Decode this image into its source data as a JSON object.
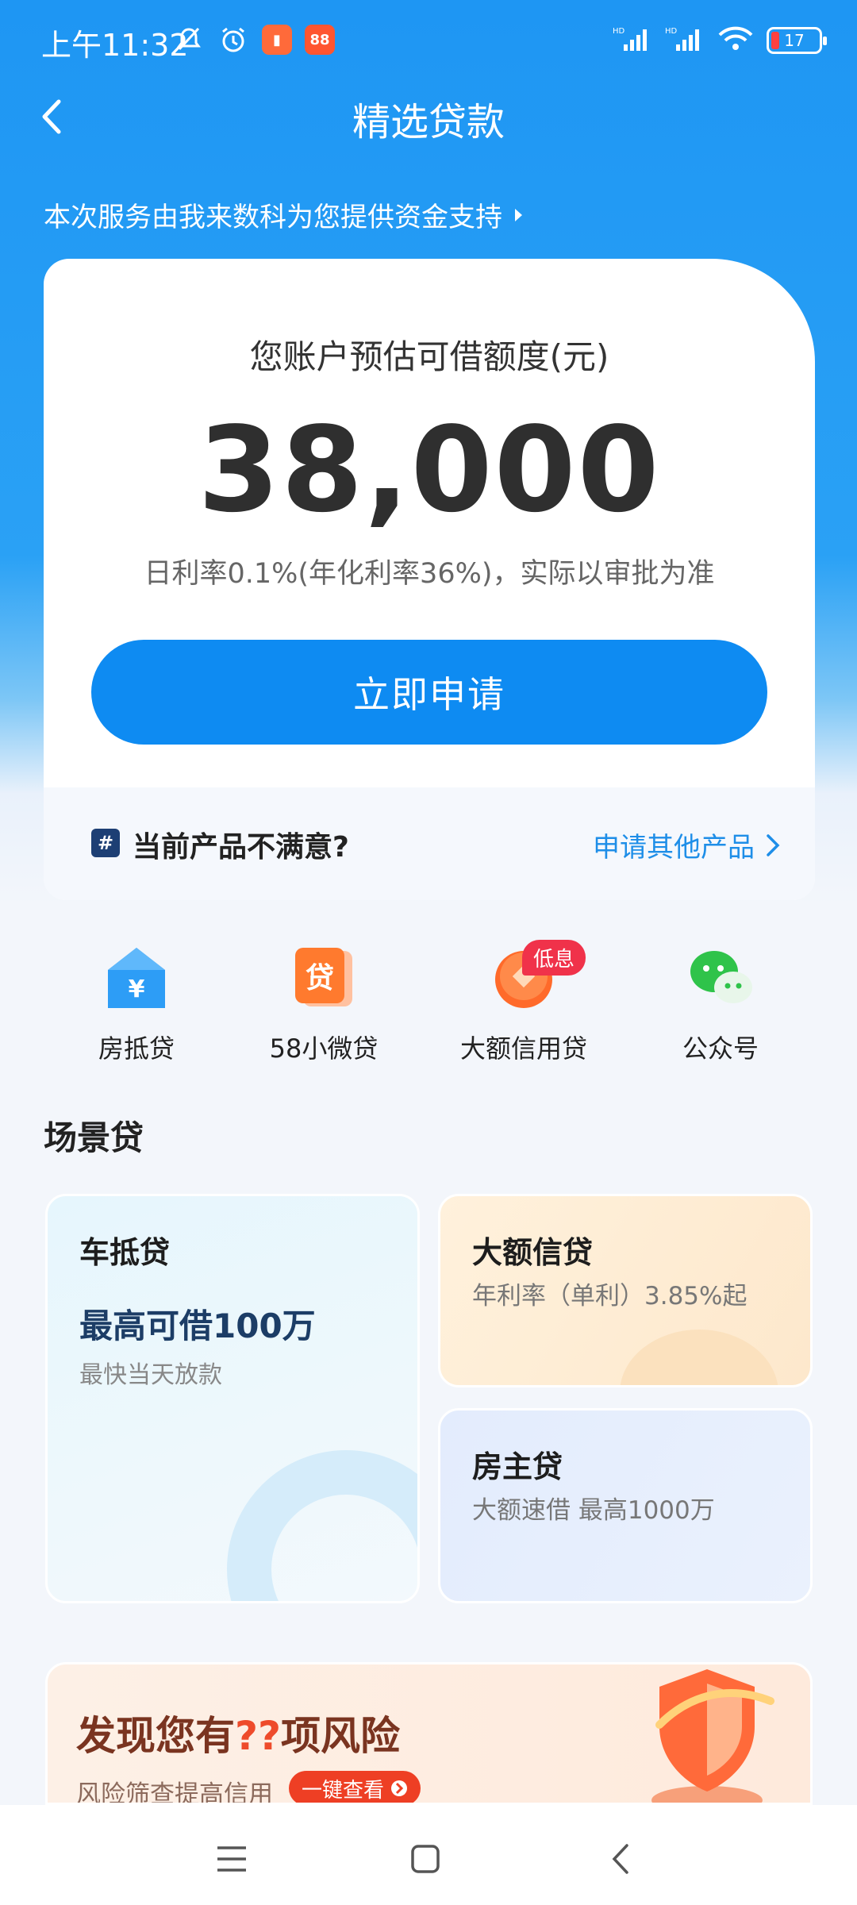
{
  "status_bar": {
    "time": "上午11:32",
    "battery": "17"
  },
  "nav": {
    "title": "精选贷款"
  },
  "provider_note": "本次服务由我来数科为您提供资金支持",
  "quota": {
    "label": "您账户预估可借额度(元)",
    "amount": "38,000",
    "rate_note": "日利率0.1%(年化利率36%)，实际以审批为准",
    "apply_label": "立即申请"
  },
  "card_footer": {
    "text": "当前产品不满意?",
    "link": "申请其他产品"
  },
  "quick_entries": [
    {
      "label": "房抵贷",
      "icon": "house-yuan-icon"
    },
    {
      "label": "58小微贷",
      "icon": "loan-box-icon"
    },
    {
      "label": "大额信用贷",
      "icon": "coin-icon",
      "tag": "低息"
    },
    {
      "label": "公众号",
      "icon": "wechat-icon"
    }
  ],
  "section_title": "场景贷",
  "scene_cards": {
    "car": {
      "title": "车抵贷",
      "highlight": "最高可借100万",
      "sub": "最快当天放款"
    },
    "big": {
      "title": "大额信贷",
      "sub": "年利率（单利）3.85%起"
    },
    "house": {
      "title": "房主贷",
      "sub": "大额速借 最高1000万"
    }
  },
  "risk": {
    "title_prefix": "发现您有",
    "title_highlight": "??",
    "title_suffix": "项风险",
    "sub": "风险筛查提高信用",
    "button": "一键查看"
  },
  "colors": {
    "primary": "#0e8bf2",
    "header": "#1e96f3",
    "tag_red": "#f0324a",
    "risk_red": "#ee4b2b"
  }
}
